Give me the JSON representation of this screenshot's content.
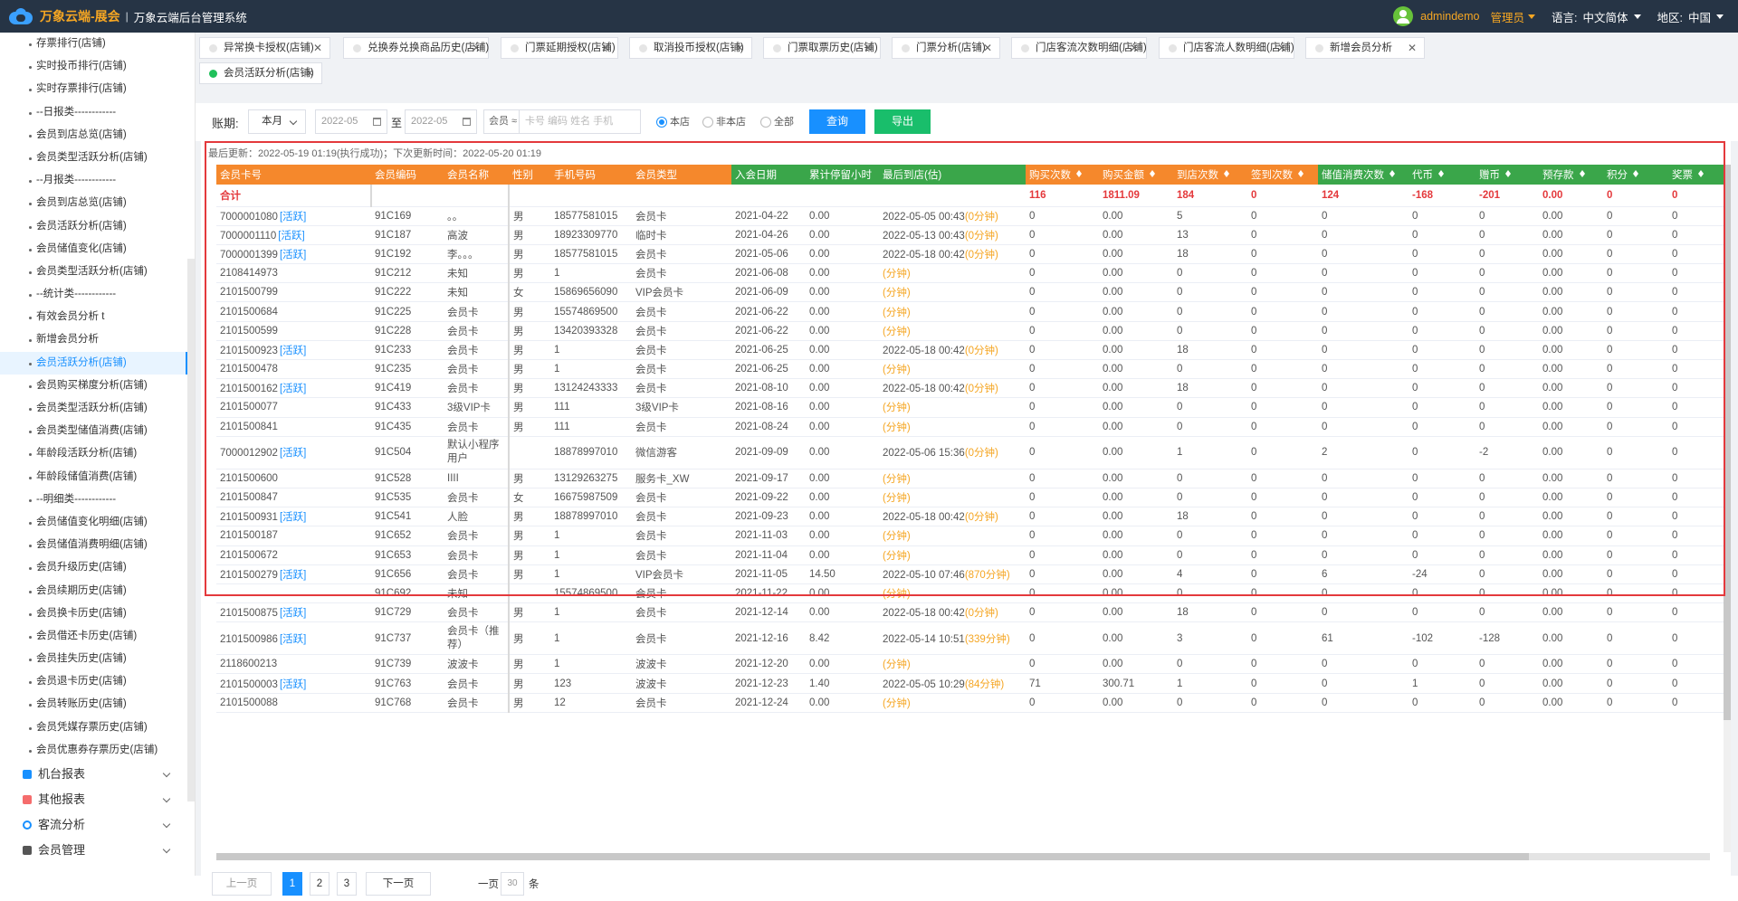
{
  "header": {
    "brand": "万象云端-展会",
    "separator": "|",
    "system": "万象云端后台管理系统",
    "user": "admindemo",
    "role": "管理员",
    "language_label": "语言:",
    "language": "中文简体",
    "region_label": "地区:",
    "region": "中国"
  },
  "sidebar": {
    "items": [
      "存票排行(店铺)",
      "实时投币排行(店铺)",
      "实时存票排行(店铺)",
      "--日报类------------",
      "会员到店总览(店铺)",
      "会员类型活跃分析(店铺)",
      "--月报类------------",
      "会员到店总览(店铺)",
      "会员活跃分析(店铺)",
      "会员储值变化(店铺)",
      "会员类型活跃分析(店铺)",
      "--统计类------------",
      "有效会员分析 t",
      "新增会员分析",
      "会员活跃分析(店铺)",
      "会员购买梯度分析(店铺)",
      "会员类型活跃分析(店铺)",
      "会员类型储值消费(店铺)",
      "年龄段活跃分析(店铺)",
      "年龄段储值消费(店铺)",
      "--明细类------------",
      "会员储值变化明细(店铺)",
      "会员储值消费明细(店铺)",
      "会员升级历史(店铺)",
      "会员续期历史(店铺)",
      "会员换卡历史(店铺)",
      "会员借还卡历史(店铺)",
      "会员挂失历史(店铺)",
      "会员退卡历史(店铺)",
      "会员转账历史(店铺)",
      "会员凭媒存票历史(店铺)",
      "会员优惠券存票历史(店铺)"
    ],
    "active_index": 14,
    "groups": [
      "机台报表",
      "其他报表",
      "客流分析",
      "会员管理"
    ]
  },
  "tabs": [
    {
      "label": "异常换卡授权(店铺)"
    },
    {
      "label": "兑换券兑换商品历史(店铺)"
    },
    {
      "label": "门票延期授权(店铺)"
    },
    {
      "label": "取消投币授权(店铺)"
    },
    {
      "label": "门票取票历史(店铺)"
    },
    {
      "label": "门票分析(店铺)"
    },
    {
      "label": "门店客流次数明细(店铺)"
    },
    {
      "label": "门店客流人数明细(店铺)"
    },
    {
      "label": "新增会员分析"
    },
    {
      "label": "会员活跃分析(店铺)"
    }
  ],
  "tab_close": "✕",
  "filter": {
    "label": "账期:",
    "period": "本月",
    "date_from": "2022-05",
    "to_label": "至",
    "date_to": "2022-05",
    "kind": "会员 ≈",
    "search_placeholder": "卡号 编码 姓名 手机",
    "radios": [
      "本店",
      "非本店",
      "全部"
    ],
    "query_button": "查询",
    "export_button": "导出"
  },
  "update_info": "最后更新：2022-05-19 01:19(执行成功)；下次更新时间：2022-05-20 01:19",
  "columns": [
    "会员卡号",
    "会员编码",
    "会员名称",
    "性别",
    "手机号码",
    "会员类型",
    "入会日期",
    "累计停留小时",
    "最后到店(估)",
    "购买次数",
    "购买金额",
    "到店次数",
    "签到次数",
    "储值消费次数",
    "代币",
    "赠币",
    "预存款",
    "积分",
    "奖票"
  ],
  "totals": {
    "label": "合计",
    "buy_count": "116",
    "buy_amount": "1811.09",
    "visits": "184",
    "signins": "0",
    "stored_count": "124",
    "coin": "-168",
    "gift": "-201",
    "prepaid": "0.00",
    "points": "0",
    "tickets": "0"
  },
  "rows": [
    {
      "card": "7000001080",
      "tag": "[活跃]",
      "code": "91C169",
      "name": "。。",
      "gender": "男",
      "phone": "18577581015",
      "type": "会员卡",
      "join": "2021-04-22",
      "hours": "0.00",
      "last": "2022-05-05 00:43",
      "dur": "(0分钟)",
      "buy": "0",
      "amount": "0.00",
      "visit": "5",
      "sign": "0",
      "stored": "0",
      "coin": "0",
      "gift": "0",
      "pre": "0.00",
      "pts": "0",
      "tix": "0"
    },
    {
      "card": "7000001110",
      "tag": "[活跃]",
      "code": "91C187",
      "name": "高波",
      "gender": "男",
      "phone": "18923309770",
      "type": "临时卡",
      "join": "2021-04-26",
      "hours": "0.00",
      "last": "2022-05-13 00:43",
      "dur": "(0分钟)",
      "buy": "0",
      "amount": "0.00",
      "visit": "13",
      "sign": "0",
      "stored": "0",
      "coin": "0",
      "gift": "0",
      "pre": "0.00",
      "pts": "0",
      "tix": "0"
    },
    {
      "card": "7000001399",
      "tag": "[活跃]",
      "code": "91C192",
      "name": "李。。。",
      "gender": "男",
      "phone": "18577581015",
      "type": "会员卡",
      "join": "2021-05-06",
      "hours": "0.00",
      "last": "2022-05-18 00:42",
      "dur": "(0分钟)",
      "buy": "0",
      "amount": "0.00",
      "visit": "18",
      "sign": "0",
      "stored": "0",
      "coin": "0",
      "gift": "0",
      "pre": "0.00",
      "pts": "0",
      "tix": "0"
    },
    {
      "card": "2108414973",
      "tag": "",
      "code": "91C212",
      "name": "未知",
      "gender": "男",
      "phone": "1",
      "type": "会员卡",
      "join": "2021-06-08",
      "hours": "0.00",
      "last": "",
      "dur": "(分钟)",
      "buy": "0",
      "amount": "0.00",
      "visit": "0",
      "sign": "0",
      "stored": "0",
      "coin": "0",
      "gift": "0",
      "pre": "0.00",
      "pts": "0",
      "tix": "0"
    },
    {
      "card": "2101500799",
      "tag": "",
      "code": "91C222",
      "name": "未知",
      "gender": "女",
      "phone": "15869656090",
      "type": "VIP会员卡",
      "join": "2021-06-09",
      "hours": "0.00",
      "last": "",
      "dur": "(分钟)",
      "buy": "0",
      "amount": "0.00",
      "visit": "0",
      "sign": "0",
      "stored": "0",
      "coin": "0",
      "gift": "0",
      "pre": "0.00",
      "pts": "0",
      "tix": "0"
    },
    {
      "card": "2101500684",
      "tag": "",
      "code": "91C225",
      "name": "会员卡",
      "gender": "男",
      "phone": "15574869500",
      "type": "会员卡",
      "join": "2021-06-22",
      "hours": "0.00",
      "last": "",
      "dur": "(分钟)",
      "buy": "0",
      "amount": "0.00",
      "visit": "0",
      "sign": "0",
      "stored": "0",
      "coin": "0",
      "gift": "0",
      "pre": "0.00",
      "pts": "0",
      "tix": "0"
    },
    {
      "card": "2101500599",
      "tag": "",
      "code": "91C228",
      "name": "会员卡",
      "gender": "男",
      "phone": "13420393328",
      "type": "会员卡",
      "join": "2021-06-22",
      "hours": "0.00",
      "last": "",
      "dur": "(分钟)",
      "buy": "0",
      "amount": "0.00",
      "visit": "0",
      "sign": "0",
      "stored": "0",
      "coin": "0",
      "gift": "0",
      "pre": "0.00",
      "pts": "0",
      "tix": "0"
    },
    {
      "card": "2101500923",
      "tag": "[活跃]",
      "code": "91C233",
      "name": "会员卡",
      "gender": "男",
      "phone": "1",
      "type": "会员卡",
      "join": "2021-06-25",
      "hours": "0.00",
      "last": "2022-05-18 00:42",
      "dur": "(0分钟)",
      "buy": "0",
      "amount": "0.00",
      "visit": "18",
      "sign": "0",
      "stored": "0",
      "coin": "0",
      "gift": "0",
      "pre": "0.00",
      "pts": "0",
      "tix": "0"
    },
    {
      "card": "2101500478",
      "tag": "",
      "code": "91C235",
      "name": "会员卡",
      "gender": "男",
      "phone": "1",
      "type": "会员卡",
      "join": "2021-06-25",
      "hours": "0.00",
      "last": "",
      "dur": "(分钟)",
      "buy": "0",
      "amount": "0.00",
      "visit": "0",
      "sign": "0",
      "stored": "0",
      "coin": "0",
      "gift": "0",
      "pre": "0.00",
      "pts": "0",
      "tix": "0"
    },
    {
      "card": "2101500162",
      "tag": "[活跃]",
      "code": "91C419",
      "name": "会员卡",
      "gender": "男",
      "phone": "13124243333",
      "type": "会员卡",
      "join": "2021-08-10",
      "hours": "0.00",
      "last": "2022-05-18 00:42",
      "dur": "(0分钟)",
      "buy": "0",
      "amount": "0.00",
      "visit": "18",
      "sign": "0",
      "stored": "0",
      "coin": "0",
      "gift": "0",
      "pre": "0.00",
      "pts": "0",
      "tix": "0"
    },
    {
      "card": "2101500077",
      "tag": "",
      "code": "91C433",
      "name": "3级VIP卡",
      "gender": "男",
      "phone": "111",
      "type": "3级VIP卡",
      "join": "2021-08-16",
      "hours": "0.00",
      "last": "",
      "dur": "(分钟)",
      "buy": "0",
      "amount": "0.00",
      "visit": "0",
      "sign": "0",
      "stored": "0",
      "coin": "0",
      "gift": "0",
      "pre": "0.00",
      "pts": "0",
      "tix": "0"
    },
    {
      "card": "2101500841",
      "tag": "",
      "code": "91C435",
      "name": "会员卡",
      "gender": "男",
      "phone": "111",
      "type": "会员卡",
      "join": "2021-08-24",
      "hours": "0.00",
      "last": "",
      "dur": "(分钟)",
      "buy": "0",
      "amount": "0.00",
      "visit": "0",
      "sign": "0",
      "stored": "0",
      "coin": "0",
      "gift": "0",
      "pre": "0.00",
      "pts": "0",
      "tix": "0"
    },
    {
      "card": "7000012902",
      "tag": "[活跃]",
      "code": "91C504",
      "name": "默认小程序用户",
      "gender": "",
      "phone": "18878997010",
      "type": "微信游客",
      "join": "2021-09-09",
      "hours": "0.00",
      "last": "2022-05-06 15:36",
      "dur": "(0分钟)",
      "buy": "0",
      "amount": "0.00",
      "visit": "1",
      "sign": "0",
      "stored": "2",
      "coin": "0",
      "gift": "-2",
      "pre": "0.00",
      "pts": "0",
      "tix": "0",
      "tall": true
    },
    {
      "card": "2101500600",
      "tag": "",
      "code": "91C528",
      "name": "IIII",
      "gender": "男",
      "phone": "13129263275",
      "type": "服务卡_XW",
      "join": "2021-09-17",
      "hours": "0.00",
      "last": "",
      "dur": "(分钟)",
      "buy": "0",
      "amount": "0.00",
      "visit": "0",
      "sign": "0",
      "stored": "0",
      "coin": "0",
      "gift": "0",
      "pre": "0.00",
      "pts": "0",
      "tix": "0"
    },
    {
      "card": "2101500847",
      "tag": "",
      "code": "91C535",
      "name": "会员卡",
      "gender": "女",
      "phone": "16675987509",
      "type": "会员卡",
      "join": "2021-09-22",
      "hours": "0.00",
      "last": "",
      "dur": "(分钟)",
      "buy": "0",
      "amount": "0.00",
      "visit": "0",
      "sign": "0",
      "stored": "0",
      "coin": "0",
      "gift": "0",
      "pre": "0.00",
      "pts": "0",
      "tix": "0"
    },
    {
      "card": "2101500931",
      "tag": "[活跃]",
      "code": "91C541",
      "name": "人脸",
      "gender": "男",
      "phone": "18878997010",
      "type": "会员卡",
      "join": "2021-09-23",
      "hours": "0.00",
      "last": "2022-05-18 00:42",
      "dur": "(0分钟)",
      "buy": "0",
      "amount": "0.00",
      "visit": "18",
      "sign": "0",
      "stored": "0",
      "coin": "0",
      "gift": "0",
      "pre": "0.00",
      "pts": "0",
      "tix": "0"
    },
    {
      "card": "2101500187",
      "tag": "",
      "code": "91C652",
      "name": "会员卡",
      "gender": "男",
      "phone": "1",
      "type": "会员卡",
      "join": "2021-11-03",
      "hours": "0.00",
      "last": "",
      "dur": "(分钟)",
      "buy": "0",
      "amount": "0.00",
      "visit": "0",
      "sign": "0",
      "stored": "0",
      "coin": "0",
      "gift": "0",
      "pre": "0.00",
      "pts": "0",
      "tix": "0"
    },
    {
      "card": "2101500672",
      "tag": "",
      "code": "91C653",
      "name": "会员卡",
      "gender": "男",
      "phone": "1",
      "type": "会员卡",
      "join": "2021-11-04",
      "hours": "0.00",
      "last": "",
      "dur": "(分钟)",
      "buy": "0",
      "amount": "0.00",
      "visit": "0",
      "sign": "0",
      "stored": "0",
      "coin": "0",
      "gift": "0",
      "pre": "0.00",
      "pts": "0",
      "tix": "0"
    },
    {
      "card": "2101500279",
      "tag": "[活跃]",
      "code": "91C656",
      "name": "会员卡",
      "gender": "男",
      "phone": "1",
      "type": "VIP会员卡",
      "join": "2021-11-05",
      "hours": "14.50",
      "last": "2022-05-10 07:46",
      "dur": "(870分钟)",
      "buy": "0",
      "amount": "0.00",
      "visit": "4",
      "sign": "0",
      "stored": "6",
      "coin": "-24",
      "gift": "0",
      "pre": "0.00",
      "pts": "0",
      "tix": "0"
    },
    {
      "card": "",
      "tag": "",
      "code": "91C692",
      "name": "未知",
      "gender": "",
      "phone": "15574869500",
      "type": "会员卡",
      "join": "2021-11-22",
      "hours": "0.00",
      "last": "",
      "dur": "(分钟)",
      "buy": "0",
      "amount": "0.00",
      "visit": "0",
      "sign": "0",
      "stored": "0",
      "coin": "0",
      "gift": "0",
      "pre": "0.00",
      "pts": "0",
      "tix": "0"
    },
    {
      "card": "2101500875",
      "tag": "[活跃]",
      "code": "91C729",
      "name": "会员卡",
      "gender": "男",
      "phone": "1",
      "type": "会员卡",
      "join": "2021-12-14",
      "hours": "0.00",
      "last": "2022-05-18 00:42",
      "dur": "(0分钟)",
      "buy": "0",
      "amount": "0.00",
      "visit": "18",
      "sign": "0",
      "stored": "0",
      "coin": "0",
      "gift": "0",
      "pre": "0.00",
      "pts": "0",
      "tix": "0"
    },
    {
      "card": "2101500986",
      "tag": "[活跃]",
      "code": "91C737",
      "name": "会员卡（推荐）",
      "gender": "男",
      "phone": "1",
      "type": "会员卡",
      "join": "2021-12-16",
      "hours": "8.42",
      "last": "2022-05-14 10:51",
      "dur": "(339分钟)",
      "buy": "0",
      "amount": "0.00",
      "visit": "3",
      "sign": "0",
      "stored": "61",
      "coin": "-102",
      "gift": "-128",
      "pre": "0.00",
      "pts": "0",
      "tix": "0",
      "tall": true
    },
    {
      "card": "2118600213",
      "tag": "",
      "code": "91C739",
      "name": "波波卡",
      "gender": "男",
      "phone": "1",
      "type": "波波卡",
      "join": "2021-12-20",
      "hours": "0.00",
      "last": "",
      "dur": "(分钟)",
      "buy": "0",
      "amount": "0.00",
      "visit": "0",
      "sign": "0",
      "stored": "0",
      "coin": "0",
      "gift": "0",
      "pre": "0.00",
      "pts": "0",
      "tix": "0"
    },
    {
      "card": "2101500003",
      "tag": "[活跃]",
      "code": "91C763",
      "name": "会员卡",
      "gender": "男",
      "phone": "123",
      "type": "波波卡",
      "join": "2021-12-23",
      "hours": "1.40",
      "last": "2022-05-05 10:29",
      "dur": "(84分钟)",
      "buy": "71",
      "amount": "300.71",
      "visit": "1",
      "sign": "0",
      "stored": "0",
      "coin": "1",
      "gift": "0",
      "pre": "0.00",
      "pts": "0",
      "tix": "0"
    },
    {
      "card": "2101500088",
      "tag": "",
      "code": "91C768",
      "name": "会员卡",
      "gender": "男",
      "phone": "12",
      "type": "会员卡",
      "join": "2021-12-24",
      "hours": "0.00",
      "last": "",
      "dur": "(分钟)",
      "buy": "0",
      "amount": "0.00",
      "visit": "0",
      "sign": "0",
      "stored": "0",
      "coin": "0",
      "gift": "0",
      "pre": "0.00",
      "pts": "0",
      "tix": "0"
    }
  ],
  "pager": {
    "prev": "上一页",
    "pages": [
      "1",
      "2",
      "3"
    ],
    "next": "下一页",
    "per_label": "一页",
    "per_size": "30",
    "unit": "条"
  },
  "colors": {
    "orange": "#f5882c",
    "green": "#3aa64a",
    "accent": "#1890ff",
    "highlight": "#e4393c"
  }
}
